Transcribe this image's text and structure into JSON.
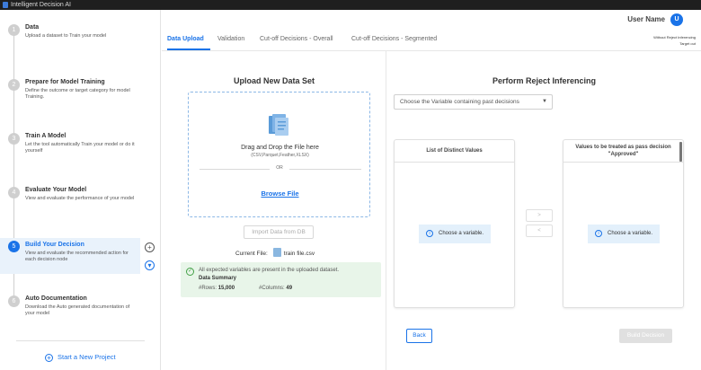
{
  "app": {
    "title": "Intelligent Decision AI"
  },
  "sidebar": {
    "steps": [
      {
        "num": "1",
        "title": "Data",
        "desc": "Upload a dataset to Train your model"
      },
      {
        "num": "2",
        "title": "Prepare for Model Training",
        "desc": "Define the outcome or target category for model Training."
      },
      {
        "num": "3",
        "title": "Train A Model",
        "desc": "Let the tool automatically Train your model or do it yourself"
      },
      {
        "num": "4",
        "title": "Evaluate Your Model",
        "desc": "View and evaluate the performance of your model"
      },
      {
        "num": "5",
        "title": "Build Your Decision",
        "desc": "View and evaluate the recommended action for each decision node"
      },
      {
        "num": "6",
        "title": "Auto Documentation",
        "desc": "Download the Auto generated documentation of your model"
      }
    ],
    "new_project": "Start a New Project"
  },
  "header": {
    "user_name": "User Name",
    "avatar": "U"
  },
  "tabs": [
    "Data Upload",
    "Validation",
    "Cut-off Decisions - Overall",
    "Cut-off Decisions - Segmented"
  ],
  "toggle": {
    "label": "Without Reject Inferencing",
    "sub": "Target out"
  },
  "upload": {
    "title": "Upload New Data Set",
    "drop_text": "Drag and Drop the File here",
    "drop_hint": "(CSV,Parquet,Feather,XLSX)",
    "or": "OR",
    "browse": "Browse File",
    "import_db": "Import Data from DB",
    "current_file_label": "Current File:",
    "current_file_name": "train file.csv",
    "success_msg": "All expected variables are present in the uploaded dataset.",
    "summary_title": "Data Summary",
    "rows_label": "#Rows:",
    "rows_value": "15,000",
    "cols_label": "#Columns:",
    "cols_value": "49"
  },
  "reject": {
    "title": "Perform Reject Inferencing",
    "dropdown": "Choose the Variable containing past decisions",
    "list_left_header": "List of Distinct Values",
    "list_right_header_1": "Values to be treated as pass decision",
    "list_right_header_2": "\"Approved\"",
    "choose_var": "Choose a variable.",
    "arrow_right": ">",
    "arrow_left": "<",
    "back": "Back",
    "build": "Build Decision"
  }
}
